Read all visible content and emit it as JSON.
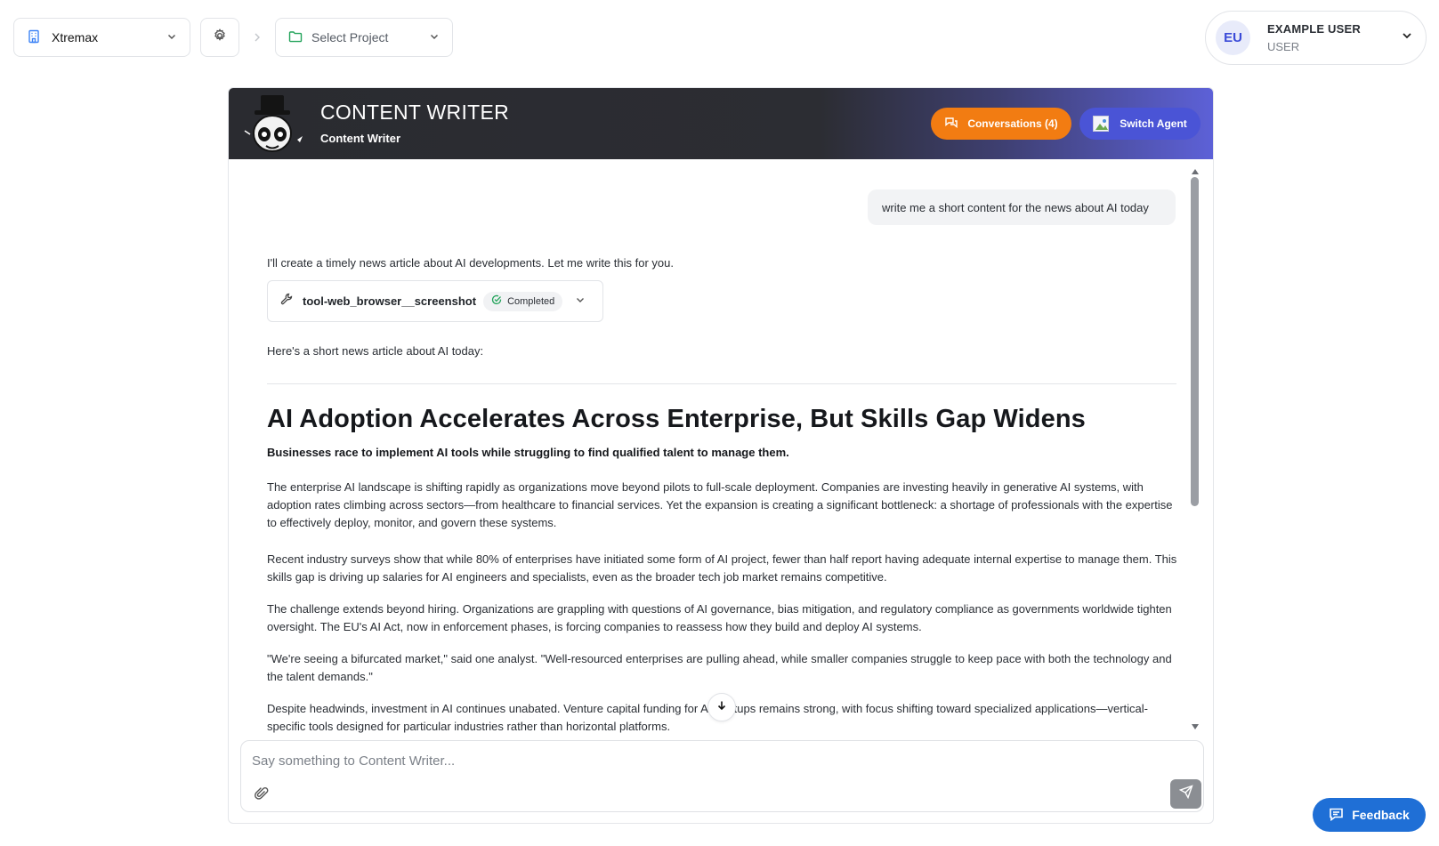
{
  "topbar": {
    "workspace": "Xtremax",
    "project_placeholder": "Select Project",
    "user": {
      "initials": "EU",
      "name": "EXAMPLE USER",
      "role": "USER"
    }
  },
  "agent": {
    "title": "CONTENT WRITER",
    "subtitle": "Content Writer",
    "conversations_label": "Conversations (4)",
    "switch_label": "Switch Agent"
  },
  "chat": {
    "user_message": "write me a short content for the news about AI today",
    "intro": "I'll create a timely news article about AI developments. Let me write this for you.",
    "tool": {
      "name": "tool-web_browser__screenshot",
      "status": "Completed"
    },
    "lead": "Here's a short news article about AI today:",
    "headline": "AI Adoption Accelerates Across Enterprise, But Skills Gap Widens",
    "subhead": "Businesses race to implement AI tools while struggling to find qualified talent to manage them.",
    "paragraphs": [
      "The enterprise AI landscape is shifting rapidly as organizations move beyond pilots to full-scale deployment. Companies are investing heavily in generative AI systems, with adoption rates climbing across sectors—from healthcare to financial services. Yet the expansion is creating a significant bottleneck: a shortage of professionals with the expertise to effectively deploy, monitor, and govern these systems.",
      "Recent industry surveys show that while 80% of enterprises have initiated some form of AI project, fewer than half report having adequate internal expertise to manage them. This skills gap is driving up salaries for AI engineers and specialists, even as the broader tech job market remains competitive.",
      "The challenge extends beyond hiring. Organizations are grappling with questions of AI governance, bias mitigation, and regulatory compliance as governments worldwide tighten oversight. The EU's AI Act, now in enforcement phases, is forcing companies to reassess how they build and deploy AI systems.",
      "\"We're seeing a bifurcated market,\" said one analyst. \"Well-resourced enterprises are pulling ahead, while smaller companies struggle to keep pace with both the technology and the talent demands.\"",
      "Despite headwinds, investment in AI continues unabated. Venture capital funding for AI startups remains strong, with focus shifting toward specialized applications—vertical-specific tools designed for particular industries rather than horizontal platforms."
    ]
  },
  "composer": {
    "placeholder": "Say something to Content Writer..."
  },
  "feedback_label": "Feedback",
  "colors": {
    "accent_orange": "#f27c12",
    "accent_indigo": "#4a54d6",
    "feedback_blue": "#1f6fd6",
    "success_green": "#22a35a"
  },
  "icons": [
    "building-icon",
    "chevron-down-icon",
    "gear-icon",
    "chevron-right-icon",
    "folder-icon",
    "agent-mascot-icon",
    "conversations-icon",
    "image-icon",
    "wrench-icon",
    "check-circle-icon",
    "arrow-down-icon",
    "paperclip-icon",
    "send-icon",
    "chat-bubble-icon"
  ]
}
